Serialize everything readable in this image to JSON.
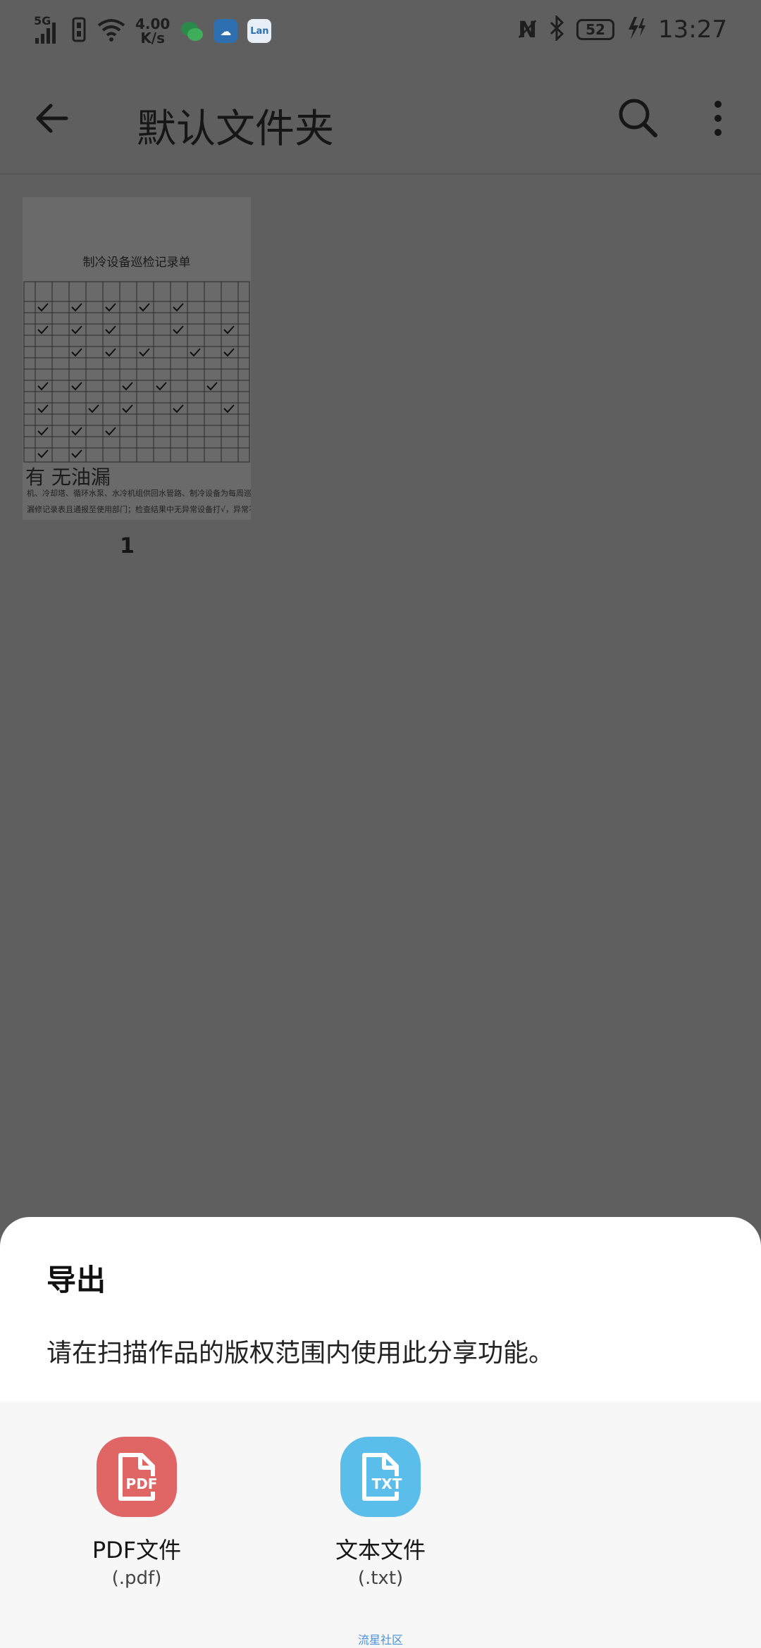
{
  "status": {
    "network": "5G",
    "speed_value": "4.00",
    "speed_unit": "K/s",
    "app_icons": [
      "wechat-icon",
      "cloud-app-icon",
      "lan-app-icon"
    ],
    "battery": "52",
    "time": "13:27"
  },
  "toolbar": {
    "title": "默认文件夹"
  },
  "document": {
    "heading": "制冷设备巡检记录单",
    "handwritten": "有 无油漏",
    "note_line1": "机、冷却塔、循环水泵、水冷机组供回水管路、制冷设备为每周巡检一次，",
    "note_line2": "漏修记录表且通报至使用部门；检查结果中无异常设备打√，异常不能运行",
    "page_number": "1"
  },
  "sheet": {
    "title": "导出",
    "description": "请在扫描作品的版权范围内使用此分享功能。",
    "options": [
      {
        "label": "PDF文件",
        "ext": "(.pdf)",
        "badge": "PDF",
        "color": "#e06666"
      },
      {
        "label": "文本文件",
        "ext": "(.txt)",
        "badge": "TXT",
        "color": "#5bbde9"
      }
    ],
    "watermark": "流星社区"
  }
}
